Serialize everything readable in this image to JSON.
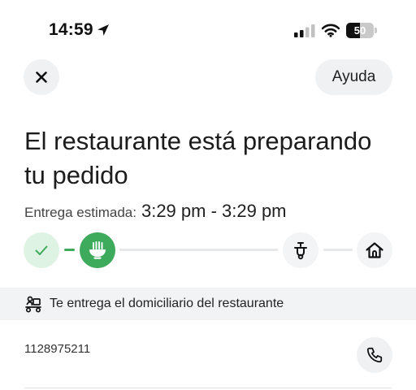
{
  "status_bar": {
    "time": "14:59",
    "battery_level": "50",
    "icons": [
      "location-arrow-icon",
      "signal-icon",
      "wifi-icon",
      "battery-icon"
    ]
  },
  "header": {
    "close_icon": "close-icon",
    "help_label": "Ayuda"
  },
  "order": {
    "title": "El restaurante está preparando tu pedido",
    "eta_label": "Entrega estimada:",
    "eta_value": "3:29 pm - 3:29 pm"
  },
  "progress": {
    "steps": [
      {
        "icon": "check-icon",
        "state": "done"
      },
      {
        "icon": "food-bowl-icon",
        "state": "active"
      },
      {
        "icon": "scooter-icon",
        "state": "pending"
      },
      {
        "icon": "home-icon",
        "state": "pending"
      }
    ],
    "colors": {
      "done_bg": "#dff3e4",
      "active_bg": "#3eaa5b",
      "pending_bg": "#f3f4f5",
      "line_active": "#3eaa5b",
      "line_pending": "#e6e7e9"
    }
  },
  "delivery": {
    "icon": "courier-icon",
    "text": "Te entrega el domiciliario del restaurante",
    "phone": "1128975211",
    "call_icon": "phone-icon"
  }
}
